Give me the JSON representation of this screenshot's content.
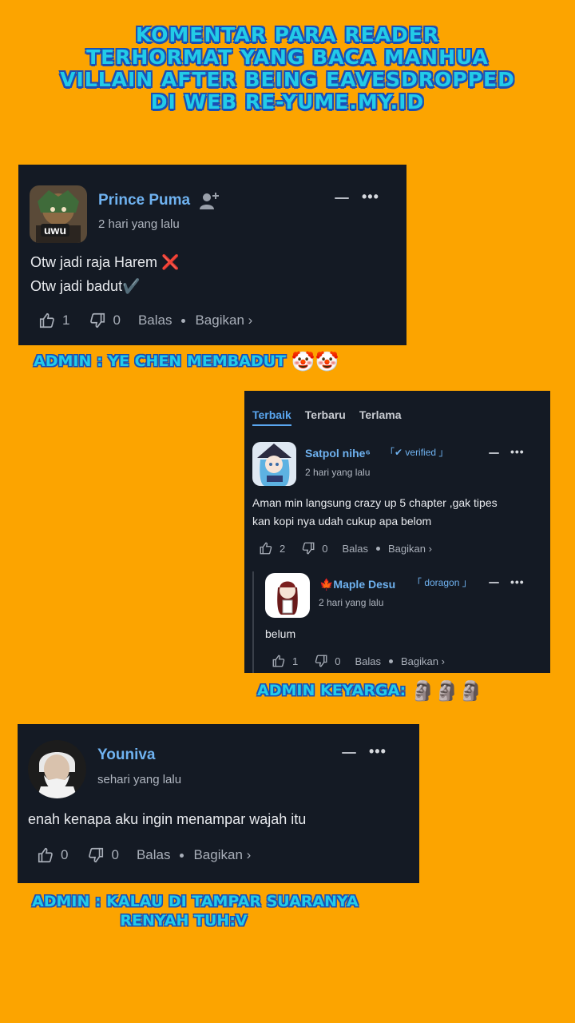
{
  "headline": {
    "line1": "KOMENTAR PARA READER",
    "line2": "TERHORMAT YANG BACA MANHUA",
    "line3": "VILLAIN AFTER BEING EAVESDROPPED",
    "line4": "DI WEB RE-YUME.MY.ID"
  },
  "comment1": {
    "username": "Prince Puma",
    "time": "2 hari yang lalu",
    "line1": "Otw jadi raja Harem ❌",
    "line2": "Otw jadi badut✔️",
    "likes": "1",
    "dislikes": "0",
    "reply_label": "Balas",
    "share_label": "Bagikan ›",
    "avatar_text": "uwu"
  },
  "admin1": {
    "text": "ADMIN : YE CHEN MEMBADUT",
    "emoji": "🤡🤡"
  },
  "thread": {
    "tabs": [
      "Terbaik",
      "Terbaru",
      "Terlama"
    ],
    "comment": {
      "username": "Satpol nihe⁶",
      "badge": "「✔ verified 」",
      "time": "2 hari yang lalu",
      "line1": "Aman min langsung crazy up 5 chapter ,gak tipes",
      "line2": "kan kopi nya udah cukup apa belom",
      "likes": "2",
      "dislikes": "0",
      "reply_label": "Balas",
      "share_label": "Bagikan ›"
    },
    "reply": {
      "username": "🍁Maple Desu",
      "badge": "「 doragon 」",
      "time": "2 hari yang lalu",
      "text": "belum",
      "likes": "1",
      "dislikes": "0",
      "reply_label": "Balas",
      "share_label": "Bagikan ›"
    }
  },
  "admin2": {
    "text": "ADMIN KEYARGA:",
    "emoji": "🗿🗿🗿"
  },
  "comment3": {
    "username": "Youniva",
    "time": "sehari yang lalu",
    "text": "enah kenapa aku ingin menampar wajah itu",
    "likes": "0",
    "dislikes": "0",
    "reply_label": "Balas",
    "share_label": "Bagikan ›"
  },
  "admin3": {
    "line1": "ADMIN : KALAU DI TAMPAR SUARANYA",
    "line2": "RENYAH TUH:V"
  },
  "colors": {
    "background": "#fca400",
    "card": "#141a24",
    "username": "#6fb2f0",
    "headline": "#22cbe8"
  }
}
